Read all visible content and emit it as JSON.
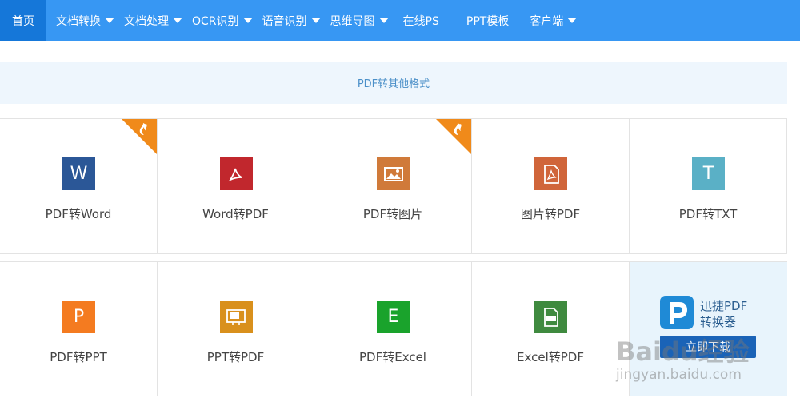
{
  "nav": {
    "items": [
      {
        "label": "首页",
        "dropdown": false
      },
      {
        "label": "文档转换",
        "dropdown": true
      },
      {
        "label": "文档处理",
        "dropdown": true
      },
      {
        "label": "OCR识别",
        "dropdown": true
      },
      {
        "label": "语音识别",
        "dropdown": true
      },
      {
        "label": "思维导图",
        "dropdown": true
      },
      {
        "label": "在线PS",
        "dropdown": false
      },
      {
        "label": "PPT模板",
        "dropdown": false
      },
      {
        "label": "客户端",
        "dropdown": true
      }
    ]
  },
  "category": {
    "title": "PDF转其他格式"
  },
  "tiles": [
    {
      "label": "PDF转Word",
      "glyph": "W",
      "color": "#2b5797",
      "hot": true
    },
    {
      "label": "Word转PDF",
      "glyph": "pdf-acrobat-icon",
      "color": "#c1272d",
      "hot": false
    },
    {
      "label": "PDF转图片",
      "glyph": "image-icon",
      "color": "#d07a3a",
      "hot": true
    },
    {
      "label": "图片转PDF",
      "glyph": "pdf-acrobat-icon",
      "color": "#d0653a",
      "hot": false
    },
    {
      "label": "PDF转TXT",
      "glyph": "T",
      "color": "#5ab0c6",
      "hot": false
    },
    {
      "label": "PDF转PPT",
      "glyph": "P",
      "color": "#f47b20",
      "hot": false
    },
    {
      "label": "PPT转PDF",
      "glyph": "pdf-file-icon",
      "color": "#d9901c",
      "hot": false
    },
    {
      "label": "PDF转Excel",
      "glyph": "E",
      "color": "#1aa32c",
      "hot": false
    },
    {
      "label": "Excel转PDF",
      "glyph": "pdf-file-icon",
      "color": "#3f8a3f",
      "hot": false
    }
  ],
  "promo": {
    "line1": "迅捷PDF",
    "line2": "转换器",
    "button": "立即下载"
  },
  "watermark": {
    "main": "Baidu经验",
    "sub": "jingyan.baidu.com"
  },
  "colors": {
    "nav_bg": "#3797f3",
    "nav_active": "#1577d9",
    "hot_badge": "#f08a1a"
  }
}
